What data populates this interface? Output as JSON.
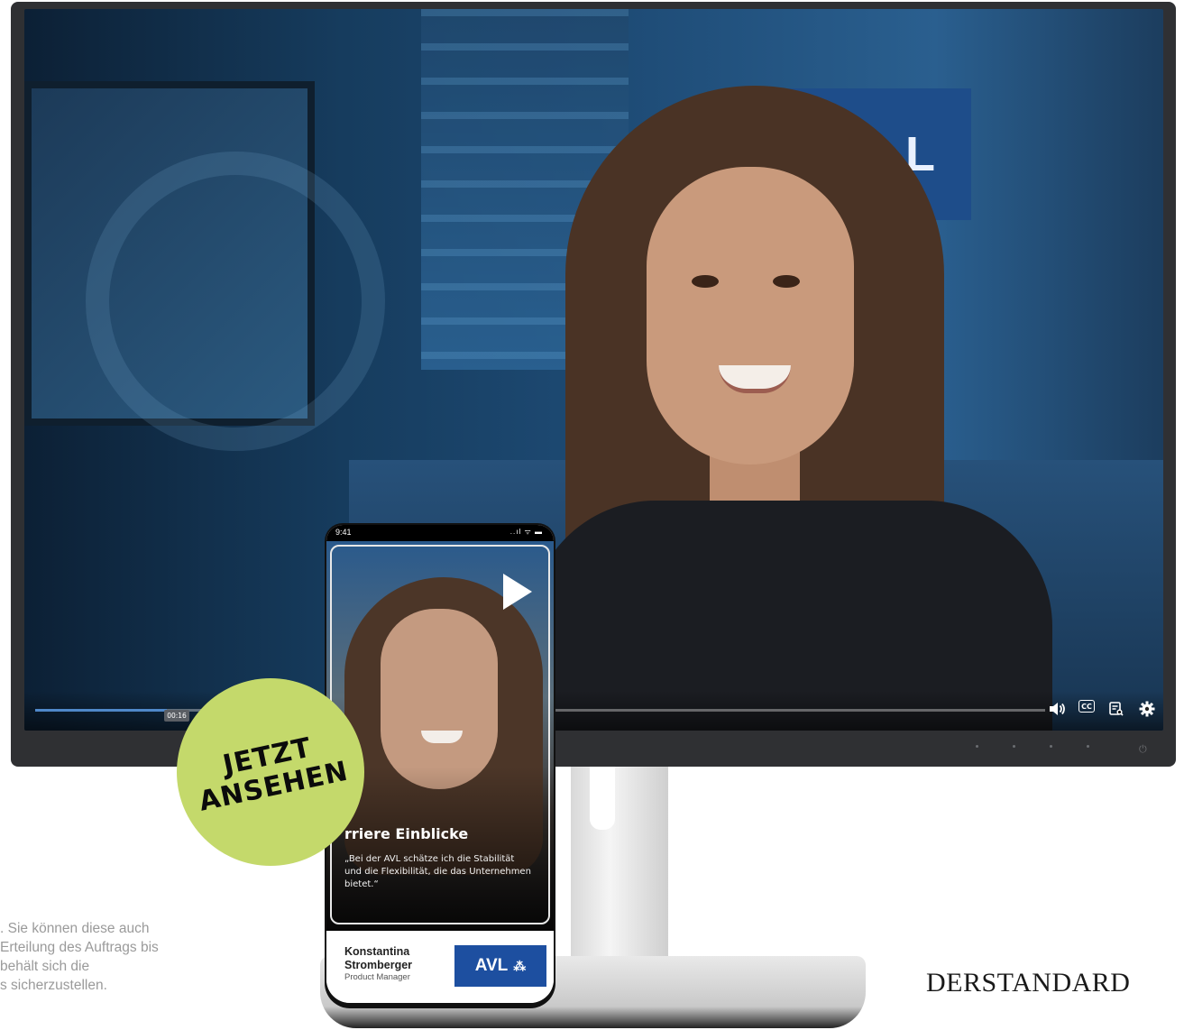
{
  "video": {
    "timestamp": "00:16",
    "progress_fraction": 0.13,
    "background_logo": "L",
    "controls": {
      "volume_icon": "volume-icon",
      "cc_label": "CC",
      "transcript_icon": "transcript-icon",
      "settings_icon": "gear-icon"
    }
  },
  "phone": {
    "status_time": "9:41",
    "status_icons": "..ıl ᯤ ▬",
    "story_title": "rriere Einblicke",
    "story_quote": "„Bei der AVL schätze ich die Stabilität und die Flexibilität, die das Unternehmen bietet.“",
    "person_first": "Konstantina",
    "person_last": "Stromberger",
    "person_role": "Product Manager",
    "logo_text": "AVL",
    "logo_mark": "⁂"
  },
  "badge": {
    "line1": "JETZT",
    "line2": "ANSEHEN",
    "color": "#c4d96b"
  },
  "disclaimer": {
    "line1": ". Sie können diese auch",
    "line2": "Erteilung des Auftrags bis",
    "line3": "behält sich die",
    "line4": "s sicherzustellen."
  },
  "brand": {
    "name": "DERSTANDARD"
  }
}
